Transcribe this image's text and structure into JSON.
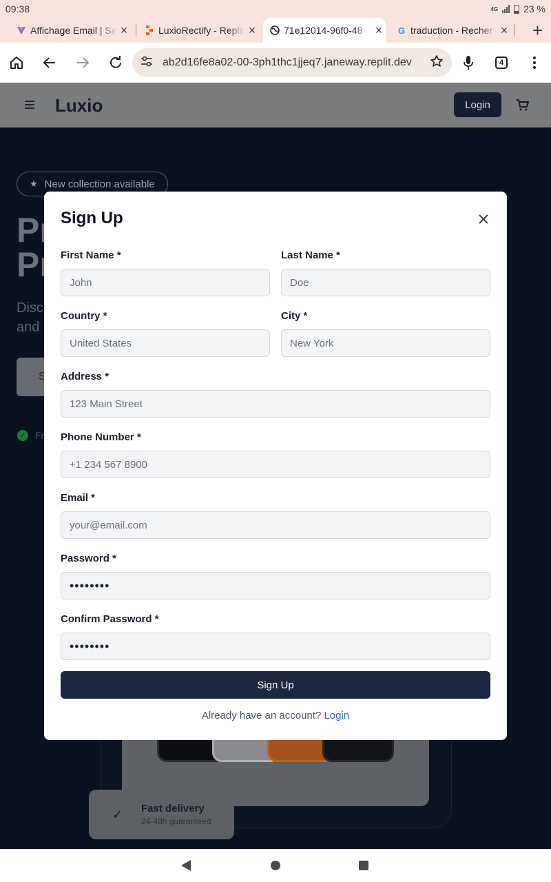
{
  "status_bar": {
    "time": "09:38",
    "network": "4G",
    "battery": "23 %"
  },
  "tabs": [
    {
      "label": "Affichage Email | Se",
      "favicon": "proton-logo-icon"
    },
    {
      "label": "LuxioRectify - Replit",
      "favicon": "replit-logo-icon"
    },
    {
      "label": "71e12014-96f0-48",
      "favicon": "globe-icon"
    },
    {
      "label": "traduction - Recher",
      "favicon": "google-logo-icon"
    }
  ],
  "omnibox": {
    "url": "ab2d16fe8a02-00-3ph1thc1jjeq7.janeway.replit.dev",
    "tab_count": "4"
  },
  "site": {
    "logo": "Luxio",
    "login_label": "Login"
  },
  "hero": {
    "pill_text": "New collection available",
    "title_line1": "Pr",
    "title_line2": "Pr",
    "subtitle_line1": "Disc",
    "subtitle_line2": "and",
    "button_text": "S",
    "feature_text": "Fr",
    "delivery_title": "Fast delivery",
    "delivery_sub": "24-48h guaranteed"
  },
  "modal": {
    "title": "Sign Up",
    "first_name": {
      "label": "First Name *",
      "placeholder": "John"
    },
    "last_name": {
      "label": "Last Name *",
      "placeholder": "Doe"
    },
    "country": {
      "label": "Country *",
      "placeholder": "United States"
    },
    "city": {
      "label": "City *",
      "placeholder": "New York"
    },
    "address": {
      "label": "Address *",
      "placeholder": "123 Main Street"
    },
    "phone": {
      "label": "Phone Number *",
      "placeholder": "+1 234 567 8900"
    },
    "email": {
      "label": "Email *",
      "placeholder": "your@email.com"
    },
    "password": {
      "label": "Password *",
      "value": "••••••••"
    },
    "confirm_password": {
      "label": "Confirm Password *",
      "value": "••••••••"
    },
    "submit_label": "Sign Up",
    "login_prompt": "Already have an account?",
    "login_link": "Login"
  },
  "colors": {
    "primary": "#1b2640",
    "link": "#2563eb",
    "browser_chrome": "#f9e4dd",
    "overlay_bg": "#0a1120"
  }
}
